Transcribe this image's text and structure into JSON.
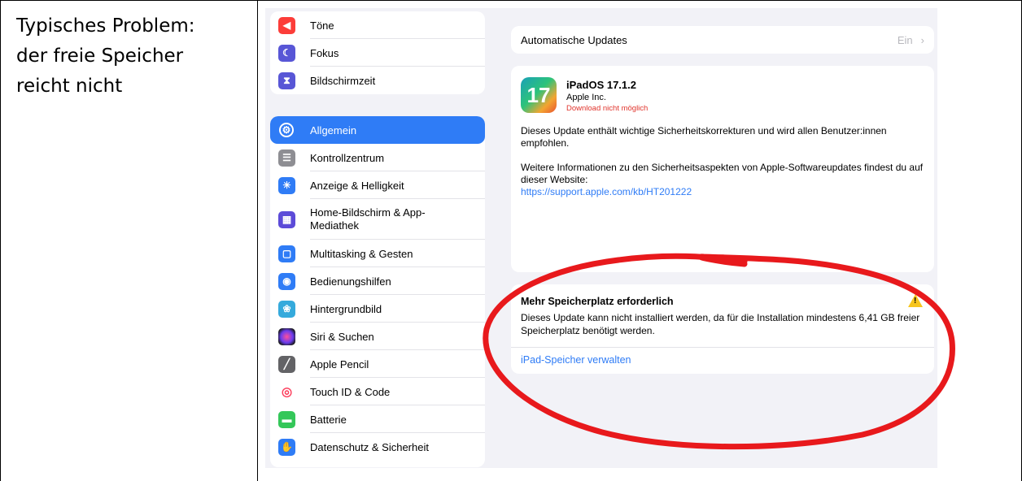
{
  "caption": [
    "Typisches Problem:",
    "der freie Speicher",
    "reicht nicht"
  ],
  "sidebar": {
    "group1": [
      {
        "label": "Töne",
        "icon": "speaker-icon",
        "color": "#fc3d39"
      },
      {
        "label": "Fokus",
        "icon": "moon-icon",
        "color": "#5856d6"
      },
      {
        "label": "Bildschirmzeit",
        "icon": "hourglass-icon",
        "color": "#5856d6"
      }
    ],
    "group2": [
      {
        "label": "Allgemein",
        "icon": "gear-icon",
        "color": "#8e8e93",
        "selected": true
      },
      {
        "label": "Kontrollzentrum",
        "icon": "toggle-icon",
        "color": "#8e8e93"
      },
      {
        "label": "Anzeige & Helligkeit",
        "icon": "sun-icon",
        "color": "#2f7cf6"
      },
      {
        "label": "Home-Bildschirm & App-Mediathek",
        "icon": "grid-icon",
        "color": "#5c4bd8"
      },
      {
        "label": "Multitasking & Gesten",
        "icon": "multitask-icon",
        "color": "#2f7cf6"
      },
      {
        "label": "Bedienungshilfen",
        "icon": "accessibility-icon",
        "color": "#2f7cf6"
      },
      {
        "label": "Hintergrundbild",
        "icon": "flower-icon",
        "color": "#35aadc"
      },
      {
        "label": "Siri & Suchen",
        "icon": "siri-icon",
        "color": "#222222"
      },
      {
        "label": "Apple Pencil",
        "icon": "pencil-icon",
        "color": "#636366"
      },
      {
        "label": "Touch ID & Code",
        "icon": "fingerprint-icon",
        "color": "#fc3d5b"
      },
      {
        "label": "Batterie",
        "icon": "battery-icon",
        "color": "#34c759"
      },
      {
        "label": "Datenschutz & Sicherheit",
        "icon": "hand-icon",
        "color": "#2f7cf6"
      }
    ]
  },
  "auto_updates": {
    "label": "Automatische Updates",
    "value": "Ein",
    "chevron": "›"
  },
  "update": {
    "app_icon_text": "17",
    "title": "iPadOS 17.1.2",
    "vendor": "Apple Inc.",
    "error": "Download nicht möglich",
    "para1": "Dieses Update enthält wichtige Sicherheitskorrekturen und wird allen Benutzer:innen empfohlen.",
    "para2": "Weitere Informationen zu den Sicherheitsaspekten von Apple-Softwareupdates findest du auf dieser Website:",
    "link": "https://support.apple.com/kb/HT201222"
  },
  "warning": {
    "title": "Mehr Speicherplatz erforderlich",
    "icon_glyph": "!",
    "text": "Dieses Update kann nicht installiert werden, da für die Installation mindestens 6,41 GB freier Speicherplatz benötigt werden.",
    "link": "iPad-Speicher verwalten"
  },
  "colors": {
    "accent": "#2f7cf6",
    "error": "#e0342c",
    "annotation": "#e8191c"
  }
}
